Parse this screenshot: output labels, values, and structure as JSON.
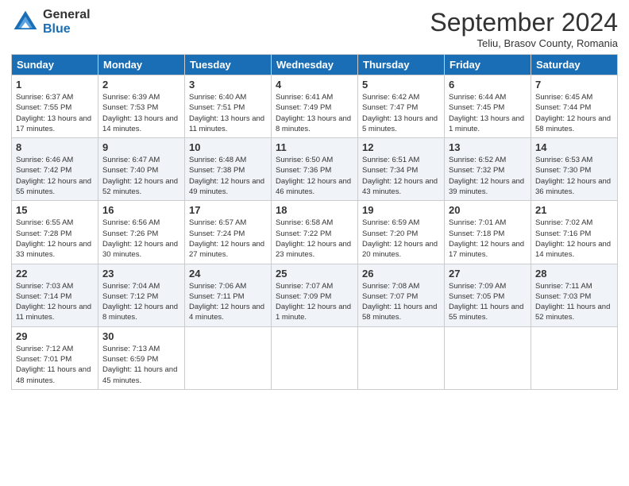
{
  "logo": {
    "general": "General",
    "blue": "Blue"
  },
  "header": {
    "month": "September 2024",
    "location": "Teliu, Brasov County, Romania"
  },
  "days_of_week": [
    "Sunday",
    "Monday",
    "Tuesday",
    "Wednesday",
    "Thursday",
    "Friday",
    "Saturday"
  ],
  "weeks": [
    [
      {
        "day": "1",
        "info": "Sunrise: 6:37 AM\nSunset: 7:55 PM\nDaylight: 13 hours and 17 minutes."
      },
      {
        "day": "2",
        "info": "Sunrise: 6:39 AM\nSunset: 7:53 PM\nDaylight: 13 hours and 14 minutes."
      },
      {
        "day": "3",
        "info": "Sunrise: 6:40 AM\nSunset: 7:51 PM\nDaylight: 13 hours and 11 minutes."
      },
      {
        "day": "4",
        "info": "Sunrise: 6:41 AM\nSunset: 7:49 PM\nDaylight: 13 hours and 8 minutes."
      },
      {
        "day": "5",
        "info": "Sunrise: 6:42 AM\nSunset: 7:47 PM\nDaylight: 13 hours and 5 minutes."
      },
      {
        "day": "6",
        "info": "Sunrise: 6:44 AM\nSunset: 7:45 PM\nDaylight: 13 hours and 1 minute."
      },
      {
        "day": "7",
        "info": "Sunrise: 6:45 AM\nSunset: 7:44 PM\nDaylight: 12 hours and 58 minutes."
      }
    ],
    [
      {
        "day": "8",
        "info": "Sunrise: 6:46 AM\nSunset: 7:42 PM\nDaylight: 12 hours and 55 minutes."
      },
      {
        "day": "9",
        "info": "Sunrise: 6:47 AM\nSunset: 7:40 PM\nDaylight: 12 hours and 52 minutes."
      },
      {
        "day": "10",
        "info": "Sunrise: 6:48 AM\nSunset: 7:38 PM\nDaylight: 12 hours and 49 minutes."
      },
      {
        "day": "11",
        "info": "Sunrise: 6:50 AM\nSunset: 7:36 PM\nDaylight: 12 hours and 46 minutes."
      },
      {
        "day": "12",
        "info": "Sunrise: 6:51 AM\nSunset: 7:34 PM\nDaylight: 12 hours and 43 minutes."
      },
      {
        "day": "13",
        "info": "Sunrise: 6:52 AM\nSunset: 7:32 PM\nDaylight: 12 hours and 39 minutes."
      },
      {
        "day": "14",
        "info": "Sunrise: 6:53 AM\nSunset: 7:30 PM\nDaylight: 12 hours and 36 minutes."
      }
    ],
    [
      {
        "day": "15",
        "info": "Sunrise: 6:55 AM\nSunset: 7:28 PM\nDaylight: 12 hours and 33 minutes."
      },
      {
        "day": "16",
        "info": "Sunrise: 6:56 AM\nSunset: 7:26 PM\nDaylight: 12 hours and 30 minutes."
      },
      {
        "day": "17",
        "info": "Sunrise: 6:57 AM\nSunset: 7:24 PM\nDaylight: 12 hours and 27 minutes."
      },
      {
        "day": "18",
        "info": "Sunrise: 6:58 AM\nSunset: 7:22 PM\nDaylight: 12 hours and 23 minutes."
      },
      {
        "day": "19",
        "info": "Sunrise: 6:59 AM\nSunset: 7:20 PM\nDaylight: 12 hours and 20 minutes."
      },
      {
        "day": "20",
        "info": "Sunrise: 7:01 AM\nSunset: 7:18 PM\nDaylight: 12 hours and 17 minutes."
      },
      {
        "day": "21",
        "info": "Sunrise: 7:02 AM\nSunset: 7:16 PM\nDaylight: 12 hours and 14 minutes."
      }
    ],
    [
      {
        "day": "22",
        "info": "Sunrise: 7:03 AM\nSunset: 7:14 PM\nDaylight: 12 hours and 11 minutes."
      },
      {
        "day": "23",
        "info": "Sunrise: 7:04 AM\nSunset: 7:12 PM\nDaylight: 12 hours and 8 minutes."
      },
      {
        "day": "24",
        "info": "Sunrise: 7:06 AM\nSunset: 7:11 PM\nDaylight: 12 hours and 4 minutes."
      },
      {
        "day": "25",
        "info": "Sunrise: 7:07 AM\nSunset: 7:09 PM\nDaylight: 12 hours and 1 minute."
      },
      {
        "day": "26",
        "info": "Sunrise: 7:08 AM\nSunset: 7:07 PM\nDaylight: 11 hours and 58 minutes."
      },
      {
        "day": "27",
        "info": "Sunrise: 7:09 AM\nSunset: 7:05 PM\nDaylight: 11 hours and 55 minutes."
      },
      {
        "day": "28",
        "info": "Sunrise: 7:11 AM\nSunset: 7:03 PM\nDaylight: 11 hours and 52 minutes."
      }
    ],
    [
      {
        "day": "29",
        "info": "Sunrise: 7:12 AM\nSunset: 7:01 PM\nDaylight: 11 hours and 48 minutes."
      },
      {
        "day": "30",
        "info": "Sunrise: 7:13 AM\nSunset: 6:59 PM\nDaylight: 11 hours and 45 minutes."
      },
      {
        "day": "",
        "info": ""
      },
      {
        "day": "",
        "info": ""
      },
      {
        "day": "",
        "info": ""
      },
      {
        "day": "",
        "info": ""
      },
      {
        "day": "",
        "info": ""
      }
    ]
  ]
}
